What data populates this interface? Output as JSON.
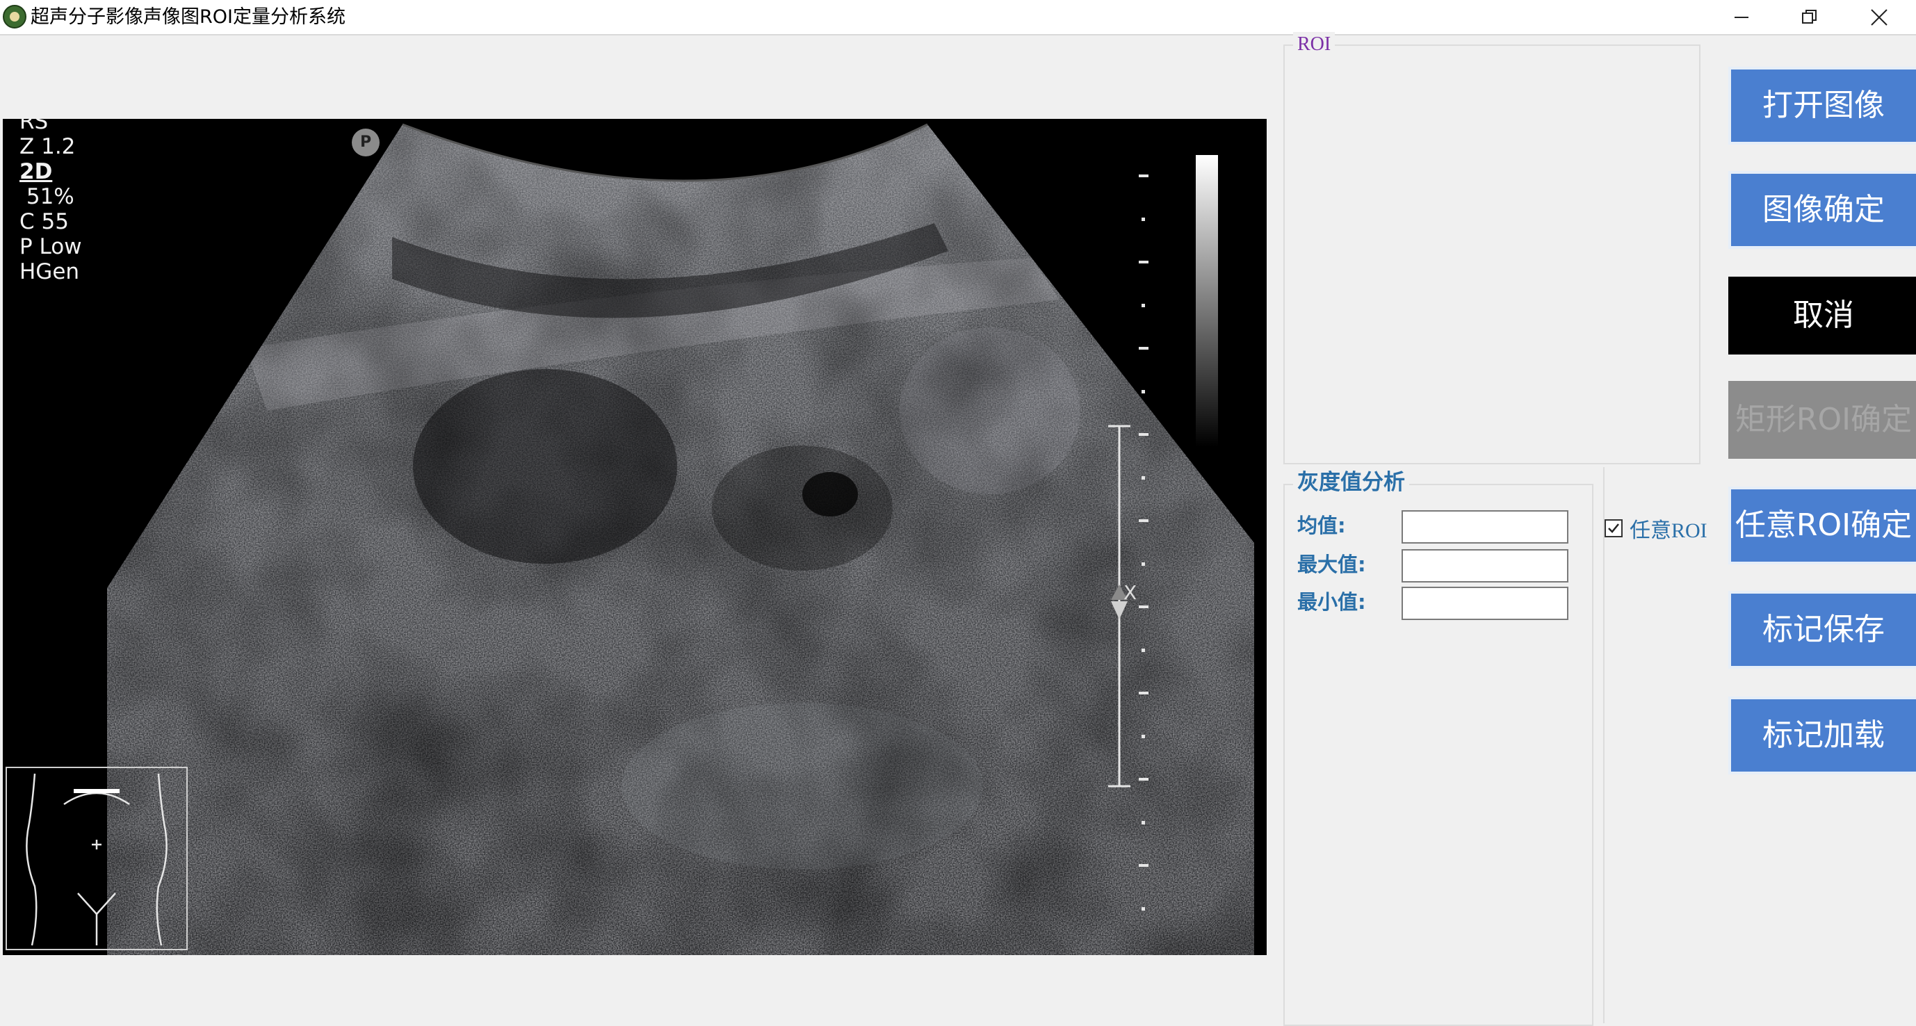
{
  "window": {
    "title": "超声分子影像声像图ROI定量分析系统",
    "controls": [
      "minimize-icon",
      "restore-icon",
      "close-icon"
    ]
  },
  "ultrasound": {
    "params": [
      "RS",
      "Z 1.2",
      "2D",
      " 51%",
      "C 55",
      "P Low",
      "HGen"
    ],
    "probe_marker": "P",
    "focus_label": "X"
  },
  "roi_panel": {
    "title": "ROI"
  },
  "gray_analysis": {
    "title": "灰度值分析",
    "fields": [
      {
        "label": "均值:",
        "value": ""
      },
      {
        "label": "最大值:",
        "value": ""
      },
      {
        "label": "最小值:",
        "value": ""
      }
    ]
  },
  "arbitrary_roi": {
    "label": "任意ROI",
    "checked": true
  },
  "buttons": {
    "open_image": "打开图像",
    "confirm_image": "图像确定",
    "cancel": "取消",
    "rect_roi_confirm": "矩形ROI确定",
    "arbitrary_roi_confirm": "任意ROI确定",
    "save_marks": "标记保存",
    "load_marks": "标记加载"
  },
  "colors": {
    "button_blue": "#4a7fd0",
    "cancel_black": "#000000",
    "disabled_gray": "#8c8c8c",
    "label_blue": "#2a6fa8",
    "roi_purple": "#7b2fa6"
  }
}
